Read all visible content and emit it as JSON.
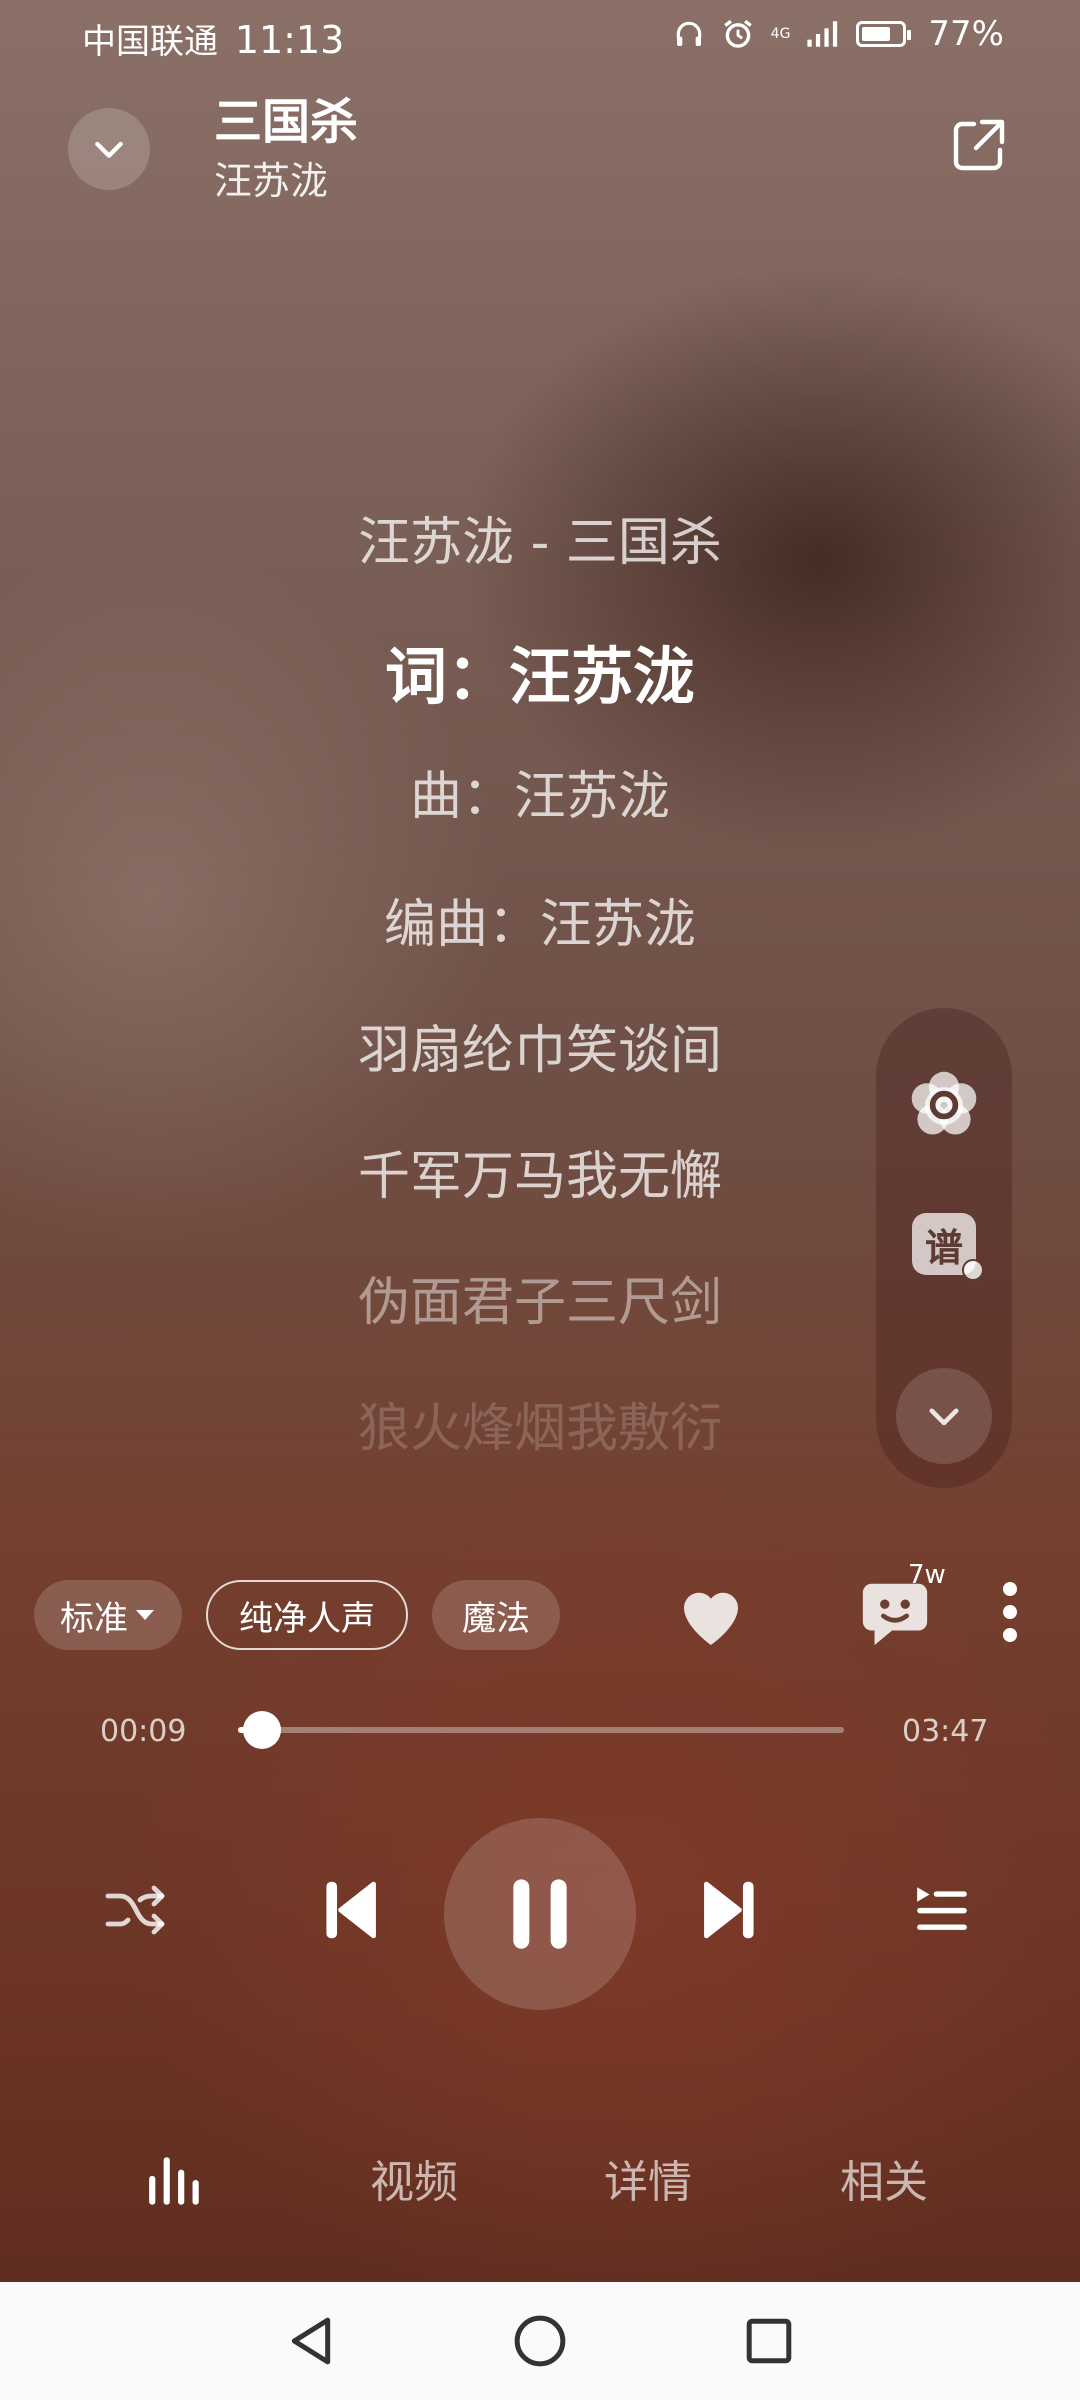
{
  "status_bar": {
    "carrier": "中国联通",
    "time": "11:13",
    "network": "4G",
    "battery_percent": "77%",
    "battery_level": 0.77
  },
  "header": {
    "title": "三国杀",
    "artist": "汪苏泷",
    "collapse_icon": "chevron-down-icon",
    "share_icon": "share-icon"
  },
  "lyrics": [
    {
      "text": "汪苏泷 - 三国杀",
      "state": "normal"
    },
    {
      "text": "词：汪苏泷",
      "state": "current"
    },
    {
      "text": "曲：汪苏泷",
      "state": "normal"
    },
    {
      "text": "编曲：汪苏泷",
      "state": "normal"
    },
    {
      "text": "羽扇纶巾笑谈间",
      "state": "normal"
    },
    {
      "text": "千军万马我无懈",
      "state": "normal"
    },
    {
      "text": "伪面君子三尺剑",
      "state": "fading"
    },
    {
      "text": "狼火烽烟我敷衍",
      "state": "faded"
    }
  ],
  "side_panel": {
    "settings_icon": "flower-settings-icon",
    "score_label": "谱",
    "collapse_icon": "chevron-down-icon"
  },
  "chips": {
    "quality": "标准",
    "vocal": "纯净人声",
    "magic": "魔法"
  },
  "actions": {
    "like_icon": "heart-icon",
    "comment_icon": "comment-icon",
    "comment_count": "7w",
    "more_icon": "more-vertical-icon"
  },
  "progress": {
    "current": "00:09",
    "total": "03:47",
    "fraction": 0.04
  },
  "controls": {
    "shuffle_icon": "shuffle-icon",
    "prev_icon": "skip-previous-icon",
    "play_state": "playing",
    "pause_icon": "pause-icon",
    "next_icon": "skip-next-icon",
    "playlist_icon": "playlist-icon"
  },
  "tabs": [
    {
      "label": "",
      "icon": "equalizer-icon",
      "active": true
    },
    {
      "label": "视频"
    },
    {
      "label": "详情"
    },
    {
      "label": "相关"
    }
  ],
  "nav_bar": {
    "back_icon": "back-triangle-icon",
    "home_icon": "home-circle-icon",
    "recents_icon": "recents-square-icon"
  }
}
